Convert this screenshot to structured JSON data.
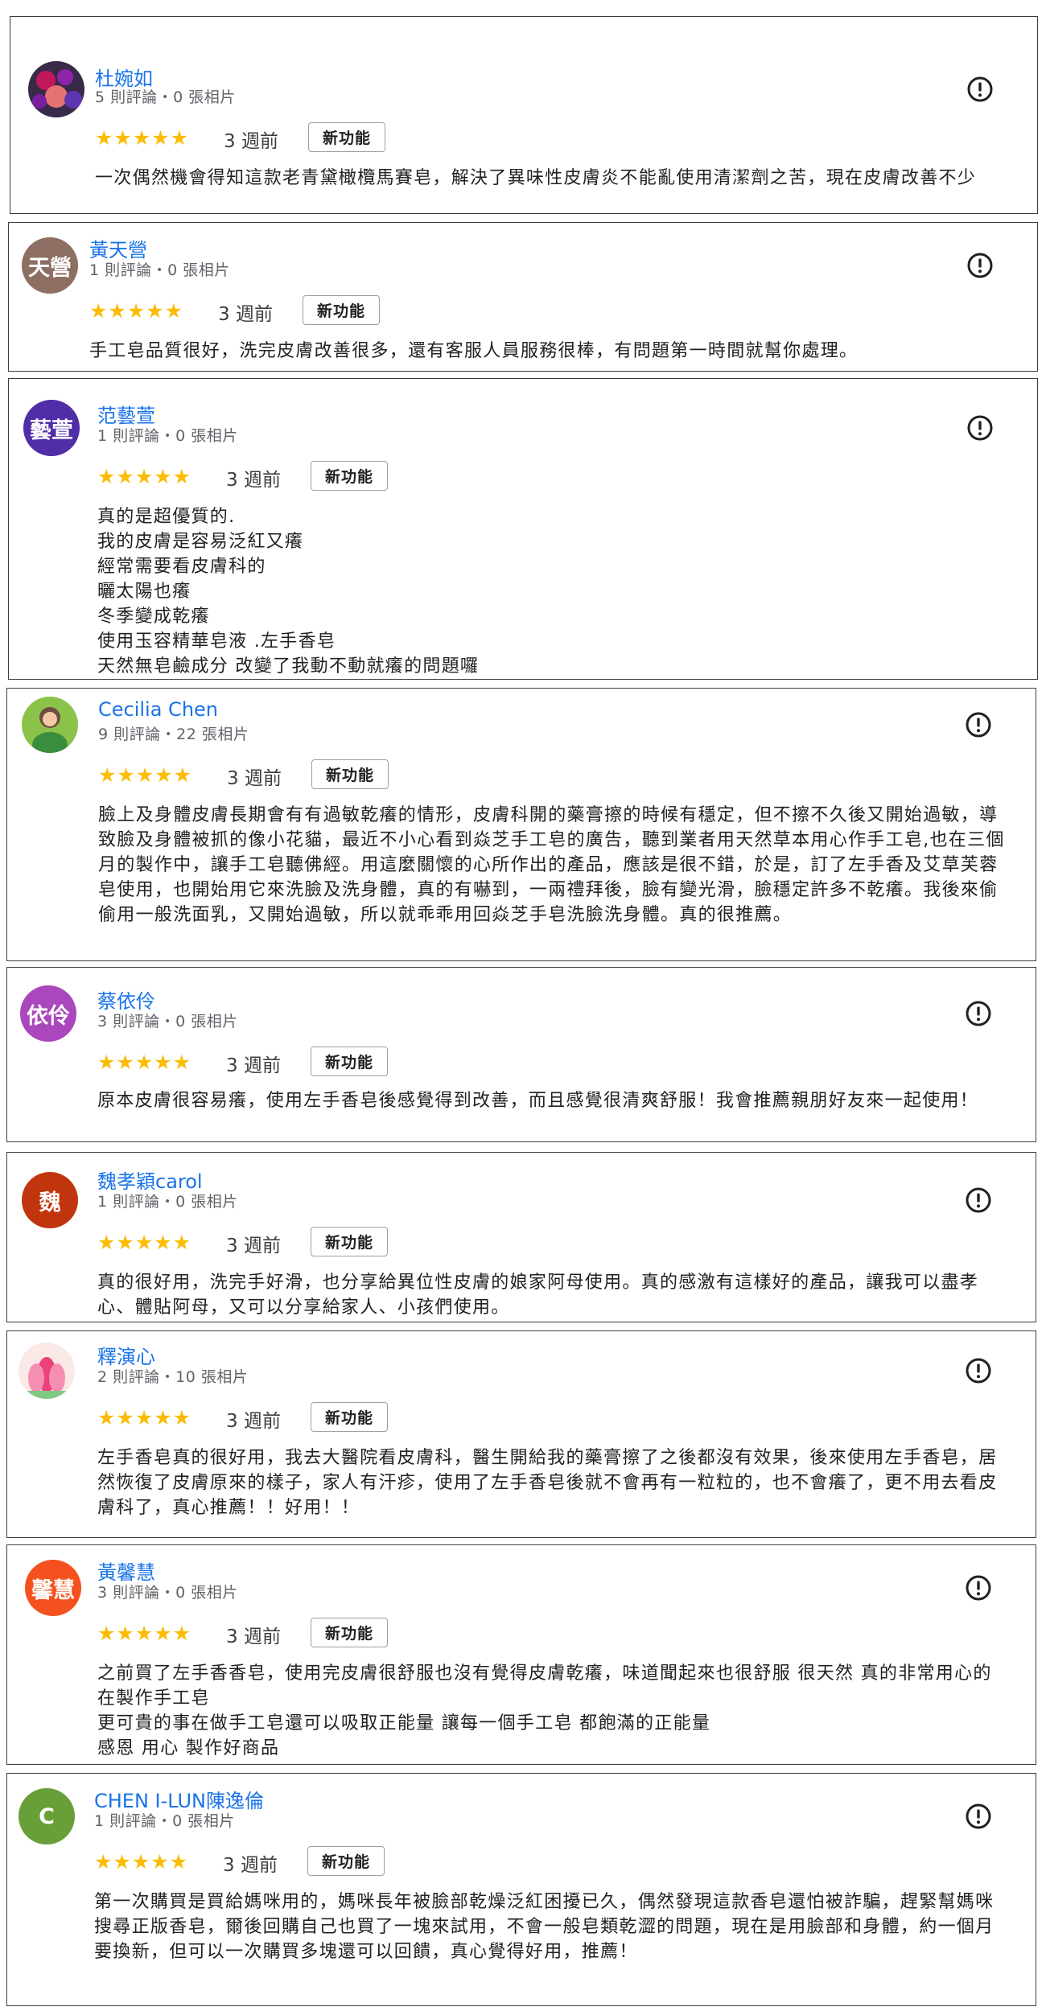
{
  "colors": {
    "name_link": "#1a73e8",
    "star": "#fbbc04",
    "meta": "#5f6368"
  },
  "reviews": [
    {
      "name": "杜婉如",
      "meta": "5 則評論・0 張相片",
      "avatar_text": "",
      "avatar_color": "#6b3d6b",
      "avatar_icon": "flower-photo-avatar",
      "stars": "★★★★★",
      "time": "3 週前",
      "badge": "新功能",
      "text": "一次偶然機會得知這款老青黛橄欖馬賽皂，解決了異味性皮膚炎不能亂使用清潔劑之苦，現在皮膚改善不少"
    },
    {
      "name": "黃天營",
      "meta": "1 則評論・0 張相片",
      "avatar_text": "天營",
      "avatar_color": "#8d6e63",
      "avatar_icon": "",
      "stars": "★★★★★",
      "time": "3 週前",
      "badge": "新功能",
      "text": "手工皂品質很好，洗完皮膚改善很多，還有客服人員服務很棒，有問題第一時間就幫你處理。"
    },
    {
      "name": "范藝萱",
      "meta": "1 則評論・0 張相片",
      "avatar_text": "藝萱",
      "avatar_color": "#512da8",
      "avatar_icon": "",
      "stars": "★★★★★",
      "time": "3 週前",
      "badge": "新功能",
      "text": "真的是超優質的.\n我的皮膚是容易泛紅又癢\n經常需要看皮膚科的\n曬太陽也癢\n冬季變成乾癢\n使用玉容精華皂液 .左手香皂\n天然無皂鹼成分 改變了我動不動就癢的問題囉"
    },
    {
      "name": "Cecilia Chen",
      "meta": "9 則評論・22 張相片",
      "avatar_text": "",
      "avatar_color": "#4e7d3a",
      "avatar_icon": "person-photo-avatar",
      "stars": "★★★★★",
      "time": "3 週前",
      "badge": "新功能",
      "text": "臉上及身體皮膚長期會有有過敏乾癢的情形，皮膚科開的藥膏擦的時候有穩定，但不擦不久後又開始過敏，導致臉及身體被抓的像小花貓，最近不小心看到焱芝手工皂的廣告，聽到業者用天然草本用心作手工皂,也在三個月的製作中，讓手工皂聽佛經。用這麼關懷的心所作出的產品，應該是很不錯，於是，訂了左手香及艾草芙蓉皂使用，也開始用它來洗臉及洗身體，真的有嚇到，一兩禮拜後，臉有變光滑，臉穩定許多不乾癢。我後來偷偷用一般洗面乳，又開始過敏，所以就乖乖用回焱芝手皂洗臉洗身體。真的很推薦。"
    },
    {
      "name": "蔡依伶",
      "meta": "3 則評論・0 張相片",
      "avatar_text": "依伶",
      "avatar_color": "#ab47bc",
      "avatar_icon": "",
      "stars": "★★★★★",
      "time": "3 週前",
      "badge": "新功能",
      "text": "原本皮膚很容易癢，使用左手香皂後感覺得到改善，而且感覺很清爽舒服！我會推薦親朋好友來一起使用！"
    },
    {
      "name": "魏孝穎carol",
      "meta": "1 則評論・0 張相片",
      "avatar_text": "魏",
      "avatar_color": "#c1350e",
      "avatar_icon": "",
      "stars": "★★★★★",
      "time": "3 週前",
      "badge": "新功能",
      "text": "真的很好用，洗完手好滑，也分享給異位性皮膚的娘家阿母使用。真的感激有這樣好的產品，讓我可以盡孝心、體貼阿母，又可以分享給家人、小孩們使用。"
    },
    {
      "name": "釋演心",
      "meta": "2 則評論・10 張相片",
      "avatar_text": "",
      "avatar_color": "#f2c6d0",
      "avatar_icon": "lotus-photo-avatar",
      "stars": "★★★★★",
      "time": "3 週前",
      "badge": "新功能",
      "text": "左手香皂真的很好用，我去大醫院看皮膚科，醫生開給我的藥膏擦了之後都沒有效果，後來使用左手香皂，居然恢復了皮膚原來的樣子，家人有汗疹，使用了左手香皂後就不會再有一粒粒的，也不會癢了，更不用去看皮膚科了，真心推薦！！好用！！"
    },
    {
      "name": "黃馨慧",
      "meta": "3 則評論・0 張相片",
      "avatar_text": "馨慧",
      "avatar_color": "#f4511e",
      "avatar_icon": "",
      "stars": "★★★★★",
      "time": "3 週前",
      "badge": "新功能",
      "text": "之前買了左手香香皂，使用完皮膚很舒服也沒有覺得皮膚乾癢，味道聞起來也很舒服 很天然 真的非常用心的在製作手工皂\n更可貴的事在做手工皂還可以吸取正能量 讓每一個手工皂 都飽滿的正能量\n感恩 用心 製作好商品"
    },
    {
      "name": "CHEN I-LUN陳逸倫",
      "meta": "1 則評論・0 張相片",
      "avatar_text": "C",
      "avatar_color": "#689f38",
      "avatar_icon": "",
      "stars": "★★★★★",
      "time": "3 週前",
      "badge": "新功能",
      "text": "第一次購買是買給媽咪用的，媽咪長年被臉部乾燥泛紅困擾已久，偶然發現這款香皂還怕被詐騙，趕緊幫媽咪搜尋正版香皂，爾後回購自己也買了一塊來試用，不會一般皂類乾澀的問題，現在是用臉部和身體，約一個月要換新，但可以一次購買多塊還可以回饋，真心覺得好用，推薦！"
    }
  ]
}
